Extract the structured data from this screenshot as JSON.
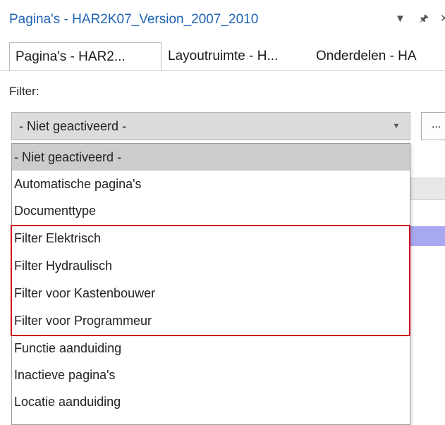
{
  "window": {
    "title": "Pagina's - HAR2K07_Version_2007_2010",
    "icons": [
      "dropdown-arrow-icon",
      "pin-icon",
      "close-icon"
    ]
  },
  "tabs": [
    {
      "label": "Pagina's - HAR2...",
      "active": true
    },
    {
      "label": "Layoutruimte - H...",
      "active": false
    },
    {
      "label": "Onderdelen - HA",
      "active": false
    }
  ],
  "filter": {
    "label": "Filter:",
    "selected_value": "- Niet geactiveerd -",
    "more_button_label": "...",
    "options": [
      "- Niet geactiveerd -",
      "Automatische pagina's",
      "Documenttype",
      "Filter Elektrisch",
      "Filter Hydraulisch",
      "Filter voor Kastenbouwer",
      "Filter voor Programmeur",
      "Functie aanduiding",
      "Inactieve pagina's",
      "Locatie aanduiding"
    ]
  },
  "colors": {
    "title_blue": "#1e63b6",
    "highlight_red": "#d0021b",
    "selected_gray": "#cccccc"
  }
}
